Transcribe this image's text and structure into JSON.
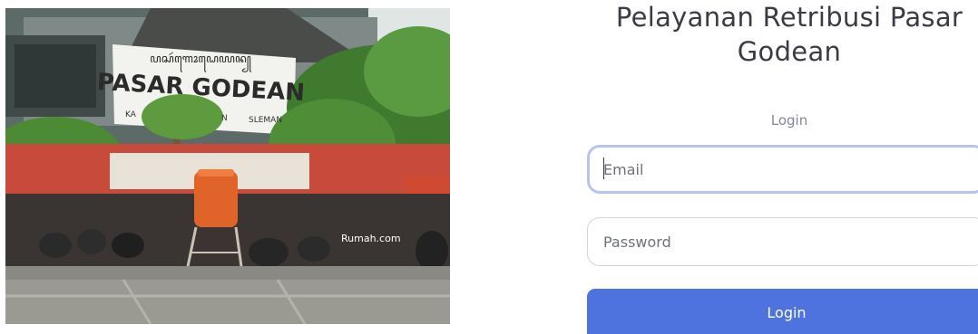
{
  "hero": {
    "sign_script": "ꦥꦱꦂꦒꦺꦴꦝꦺꦪꦤ꧀",
    "sign_main": "PASAR GODEAN",
    "sign_left": "KA",
    "sign_mid": "N",
    "sign_right": "SLEMAN",
    "watermark": "Rumah.com"
  },
  "login": {
    "title": "Pelayanan Retribusi Pasar Godean",
    "subtitle": "Login",
    "email_placeholder": "Email",
    "password_placeholder": "Password",
    "submit_label": "Login"
  },
  "colors": {
    "primary": "#4e73df",
    "focus_ring": "#b7c4f2",
    "title_text": "#3a3b45",
    "muted_text": "#858796",
    "input_border": "#d1d3e2"
  }
}
